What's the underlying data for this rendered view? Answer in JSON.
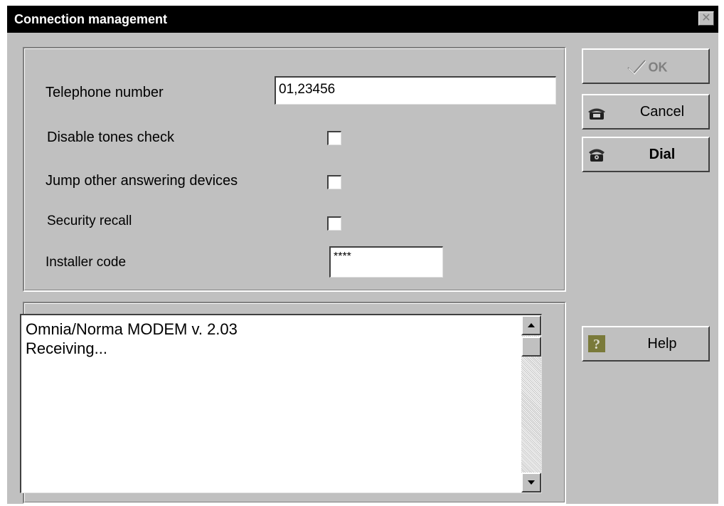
{
  "window": {
    "title": "Connection management",
    "close_glyph": "✕"
  },
  "form": {
    "telephone_label": "Telephone number",
    "telephone_value": "01,23456",
    "disable_tones_label": "Disable tones check",
    "disable_tones_checked": false,
    "jump_devices_label": "Jump other answering devices",
    "jump_devices_checked": false,
    "security_recall_label": "Security recall",
    "security_recall_checked": false,
    "installer_code_label": "Installer code",
    "installer_code_value": "****"
  },
  "buttons": {
    "ok_label": "OK",
    "ok_icon": "checkmark-icon",
    "cancel_label": "Cancel",
    "cancel_icon": "telephone-icon",
    "dial_label": "Dial",
    "dial_icon": "telephone-dial-icon",
    "help_label": "Help",
    "help_icon": "question-icon"
  },
  "log": {
    "lines": [
      "Omnia/Norma MODEM v. 2.03",
      "Receiving..."
    ]
  },
  "colors": {
    "face": "#c0c0c0",
    "titlebar": "#000000",
    "help_icon_accent": "#7a7a3a"
  }
}
